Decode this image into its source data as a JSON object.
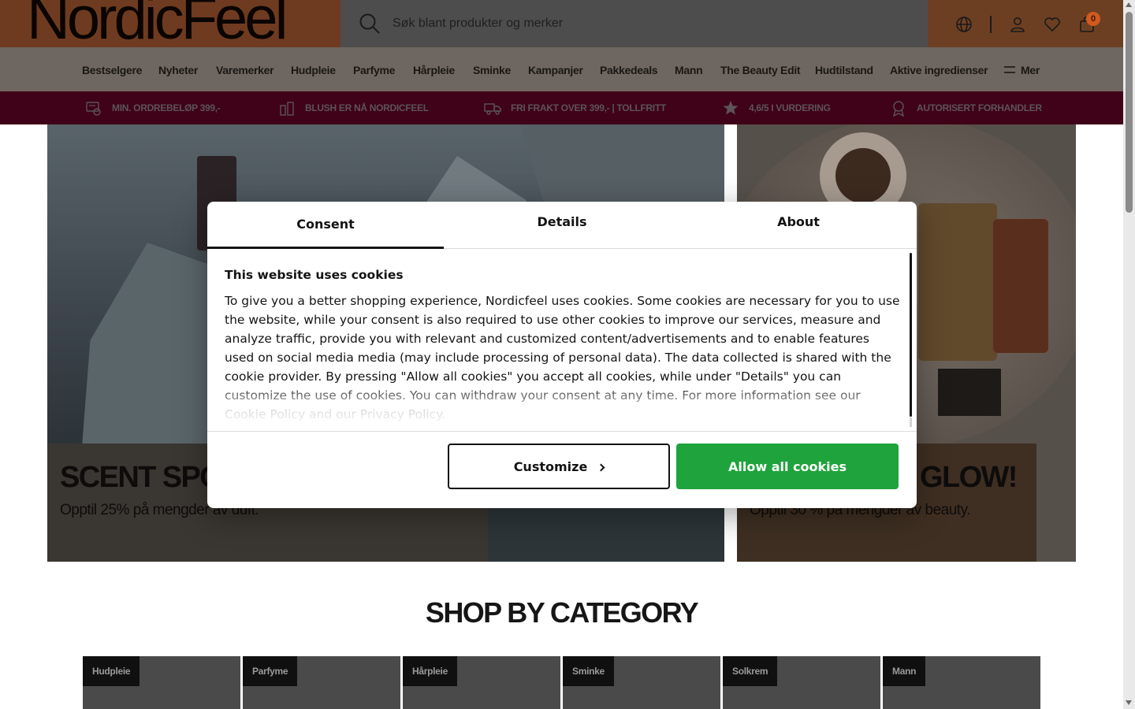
{
  "header": {
    "logo": "NordicFeel",
    "search_placeholder": "Søk blant produkter og merker",
    "cart_count": "0",
    "icons": [
      "globe-icon",
      "user-icon",
      "heart-icon",
      "bag-icon"
    ]
  },
  "nav": {
    "items": [
      "Bestselgere",
      "Nyheter",
      "Varemerker",
      "Hudpleie",
      "Parfyme",
      "Hårpleie",
      "Sminke",
      "Kampanjer",
      "Pakkedeals",
      "Mann",
      "The Beauty Edit",
      "Hudtilstand",
      "Aktive ingredienser"
    ],
    "more_label": "Mer"
  },
  "benefits": [
    {
      "icon": "receipt-icon",
      "text": "MIN. ORDREBELØP 399,-"
    },
    {
      "icon": "cosmetics-icon",
      "text": "BLUSH ER NÅ NORDICFEEL"
    },
    {
      "icon": "truck-icon",
      "text": "FRI FRAKT OVER 399,- | TOLLFRITT"
    },
    {
      "icon": "star-icon",
      "text": "4,6/5 I VURDERING"
    },
    {
      "icon": "badge-icon",
      "text": "AUTORISERT FORHANDLER"
    }
  ],
  "hero": {
    "left": {
      "title": "SCENT SPO",
      "subtitle": "Opptil 25% på mengder av duft."
    },
    "right": {
      "title": "GLOW!",
      "subtitle": "Opptil 30 % på mengder av beauty."
    }
  },
  "categories": {
    "heading": "SHOP BY CATEGORY",
    "items": [
      "Hudpleie",
      "Parfyme",
      "Hårpleie",
      "Sminke",
      "Solkrem",
      "Mann"
    ]
  },
  "cookie_modal": {
    "tabs": [
      "Consent",
      "Details",
      "About"
    ],
    "active_tab": "Consent",
    "title": "This website uses cookies",
    "body": "To give you a better shopping experience, Nordicfeel uses cookies. Some cookies are necessary for you to use the website, while your consent is also required to use other cookies to improve our services, measure and analyze traffic, provide you with relevant and customized content/advertisements and to enable features used on social media media (may include processing of personal data). The data collected is shared with the cookie provider. By pressing \"Allow all cookies\" you accept all cookies, while under \"Details\" you can customize the use of cookies. You can withdraw your consent at any time. For more information see our Cookie Policy and our Privacy Policy.",
    "customize_label": "Customize",
    "allow_label": "Allow all cookies",
    "colors": {
      "allow_button": "#1fa33c",
      "benefit_bar": "#3f0218"
    }
  }
}
